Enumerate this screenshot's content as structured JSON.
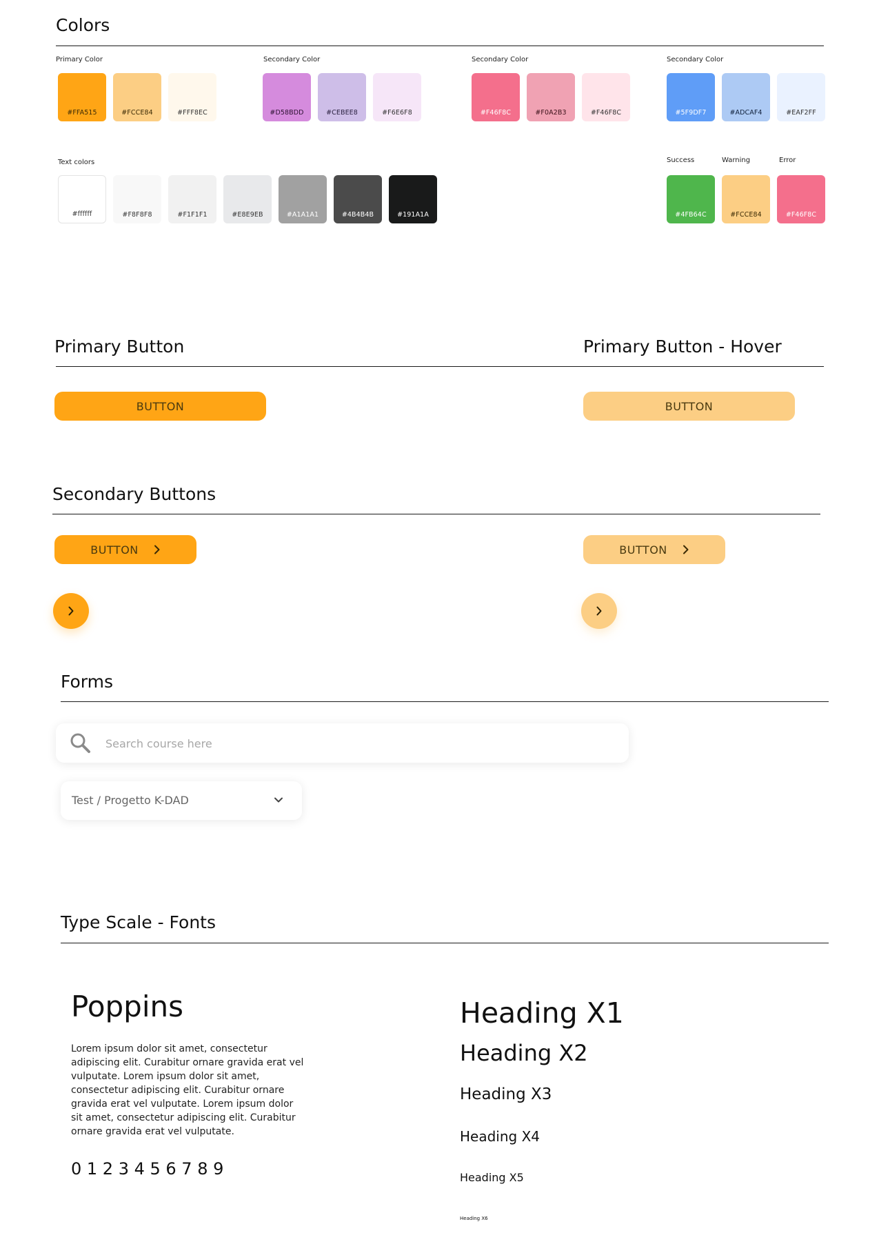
{
  "colors_section": {
    "title": "Colors",
    "groups": [
      {
        "label": "Primary Color",
        "swatches": [
          {
            "hex": "#FFA515",
            "label": "#FFA515",
            "text_color": "#3a2a05"
          },
          {
            "hex": "#FCCE84",
            "label": "#FCCE84",
            "text_color": "#3a2a05"
          },
          {
            "hex": "#FFF8EC",
            "label": "#FFF8EC",
            "text_color": "#333333"
          }
        ]
      },
      {
        "label": "Secondary Color",
        "swatches": [
          {
            "hex": "#D58BDD",
            "label": "#D58BDD",
            "text_color": "#2a1030"
          },
          {
            "hex": "#CEBEE8",
            "label": "#CEBEE8",
            "text_color": "#2a2040"
          },
          {
            "hex": "#F6E6F8",
            "label": "#F6E6F8",
            "text_color": "#333333"
          }
        ]
      },
      {
        "label": "Secondary Color",
        "swatches": [
          {
            "hex": "#F46F8C",
            "label": "#F46F8C",
            "text_color": "#ffffff"
          },
          {
            "hex": "#F0A2B3",
            "label": "#F0A2B3",
            "text_color": "#3a1018"
          },
          {
            "hex": "#FFE4EA",
            "label": "#F46F8C",
            "text_color": "#333333"
          }
        ]
      },
      {
        "label": "Secondary Color",
        "swatches": [
          {
            "hex": "#5F9DF7",
            "label": "#5F9DF7",
            "text_color": "#ffffff"
          },
          {
            "hex": "#ADCAF4",
            "label": "#ADCAF4",
            "text_color": "#10203a"
          },
          {
            "hex": "#EAF2FF",
            "label": "#EAF2FF",
            "text_color": "#333333"
          }
        ]
      }
    ],
    "text_colors": {
      "label": "Text colors",
      "swatches": [
        {
          "hex": "#ffffff",
          "label": "#ffffff",
          "text_color": "#333333"
        },
        {
          "hex": "#F8F8F8",
          "label": "#F8F8F8",
          "text_color": "#333333"
        },
        {
          "hex": "#F1F1F1",
          "label": "#F1F1F1",
          "text_color": "#333333"
        },
        {
          "hex": "#E8E9EB",
          "label": "#E8E9EB",
          "text_color": "#333333"
        },
        {
          "hex": "#A1A1A1",
          "label": "#A1A1A1",
          "text_color": "#ffffff"
        },
        {
          "hex": "#4B4B4B",
          "label": "#4B4B4B",
          "text_color": "#ffffff"
        },
        {
          "hex": "#191A1A",
          "label": "#191A1A",
          "text_color": "#ffffff"
        }
      ]
    },
    "status": [
      {
        "label": "Success",
        "hex": "#4FB64C",
        "value": "#4FB64C",
        "text_color": "#ffffff"
      },
      {
        "label": "Warning",
        "hex": "#FCCE84",
        "value": "#FCCE84",
        "text_color": "#3a2a05"
      },
      {
        "label": "Error",
        "hex": "#F46F8C",
        "value": "#F46F8C",
        "text_color": "#ffffff"
      }
    ]
  },
  "primary_button": {
    "title": "Primary Button",
    "hover_title": "Primary Button - Hover",
    "label": "BUTTON",
    "hover_label": "BUTTON",
    "color": "#FFA515",
    "hover_color": "#FCCE84"
  },
  "secondary_buttons": {
    "title": "Secondary Buttons",
    "label": "BUTTON",
    "hover_label": "BUTTON",
    "icon": "chevron-right-icon"
  },
  "forms": {
    "title": "Forms",
    "search_placeholder": "Search course here",
    "search_icon": "search-icon",
    "select_value": "Test / Progetto K-DAD",
    "select_icon": "chevron-down-icon"
  },
  "type_scale": {
    "title": "Type Scale - Fonts",
    "font_name": "Poppins",
    "lorem": "Lorem ipsum dolor sit amet, consectetur adipiscing elit. Curabitur ornare gravida erat vel vulputate.  Lorem ipsum dolor sit amet, consectetur adipiscing elit. Curabitur ornare gravida erat vel vulputate. Lorem ipsum dolor sit amet, consectetur adipiscing elit. Curabitur ornare gravida erat vel vulputate.",
    "digits": "0 1 2 3 4 5 6 7 8 9",
    "headings": [
      "Heading X1",
      "Heading X2",
      "Heading X3",
      "Heading X4",
      "Heading X5",
      "Heading X6"
    ]
  }
}
